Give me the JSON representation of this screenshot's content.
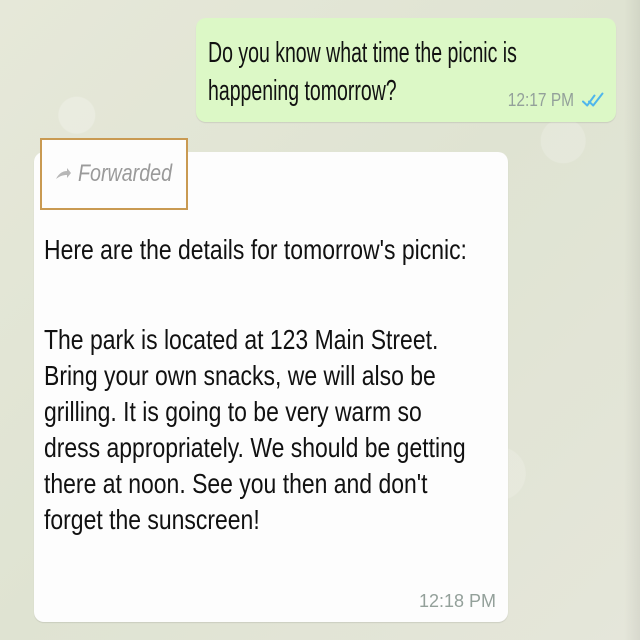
{
  "messages": [
    {
      "direction": "outgoing",
      "lines": [
        "Do you know what time the picnic is",
        "happening tomorrow?"
      ],
      "time": "12:17 PM",
      "status_icon": "double-check-icon"
    },
    {
      "direction": "incoming",
      "forwarded_label": "Forwarded",
      "lines": [
        "Here are the details for tomorrow's picnic:",
        "",
        "The park is located at 123 Main Street.",
        "Bring your own snacks, we will also be",
        "grilling. It is going to be very warm so",
        "dress appropriately. We should be getting",
        "there at noon. See you then and don't",
        "forget the sunscreen!"
      ],
      "time": "12:18 PM"
    }
  ],
  "colors": {
    "outgoing_bubble": "#dcf8c6",
    "incoming_bubble": "#fdfdfd",
    "highlight_border": "#c99a52",
    "timestamp": "#93a09a",
    "tick": "#4fb6ec"
  }
}
